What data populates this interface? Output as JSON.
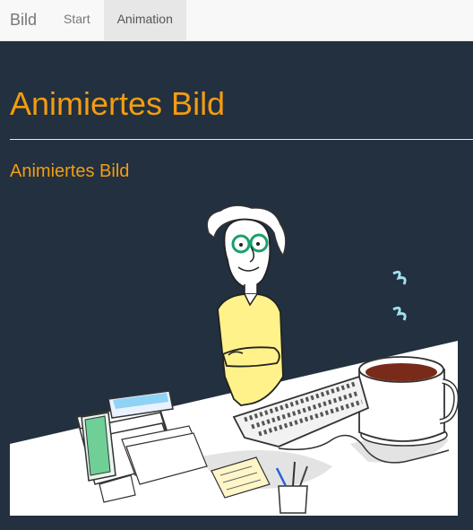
{
  "navbar": {
    "brand": "Bild",
    "items": [
      {
        "label": "Start"
      },
      {
        "label": "Animation"
      }
    ]
  },
  "main": {
    "title": "Animiertes Bild",
    "subtitle": "Animiertes Bild"
  },
  "colors": {
    "background": "#22303f",
    "accent": "#f39c12",
    "navbar": "#f8f8f8"
  }
}
